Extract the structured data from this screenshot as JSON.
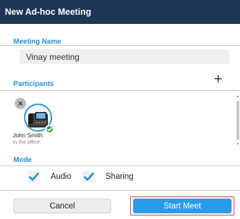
{
  "window": {
    "title": "New Ad-hoc Meeting"
  },
  "meeting_name": {
    "label": "Meeting Name",
    "value": "Vinay meeting"
  },
  "participants": {
    "label": "Participants",
    "add_symbol": "+",
    "remove_symbol": "×",
    "items": [
      {
        "name": "John Smith",
        "status": "In the office",
        "presence_color": "#3aa655"
      }
    ]
  },
  "mode": {
    "label": "Mode",
    "options": [
      {
        "label": "Audio",
        "checked": true
      },
      {
        "label": "Sharing",
        "checked": true
      }
    ]
  },
  "actions": {
    "cancel_label": "Cancel",
    "start_label": "Start Meet"
  },
  "colors": {
    "titlebar": "#1d3557",
    "accent": "#1e90d8",
    "primary_button": "#2a9bea",
    "highlight_outline": "#e03b3b"
  },
  "icons": {
    "add": "plus-icon",
    "remove": "close-icon",
    "avatar": "desk-phone-icon",
    "presence": "checkmark-icon",
    "checkbox": "checkmark-icon"
  }
}
